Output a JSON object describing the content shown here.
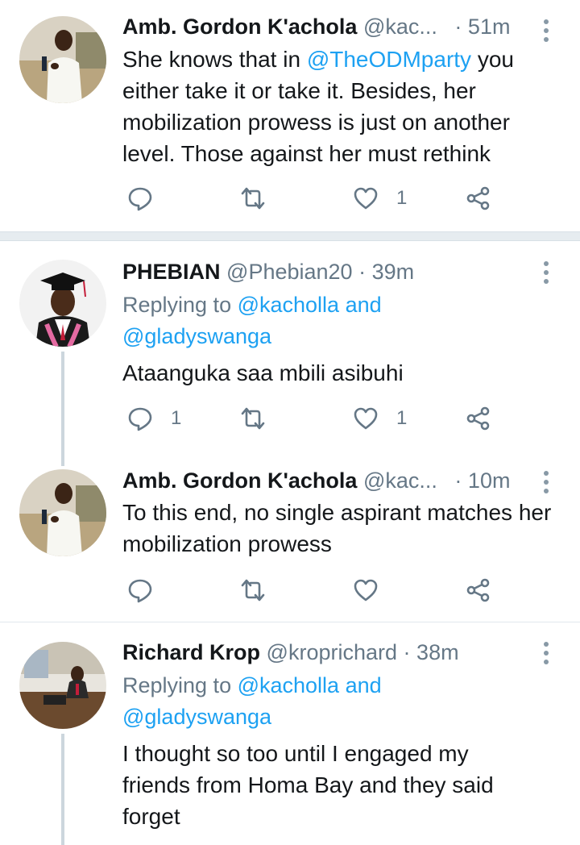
{
  "tweets": [
    {
      "name": "Amb. Gordon K'achola",
      "handle": "@kac...",
      "dot": "·",
      "time": "51m",
      "text_parts": [
        "She knows that in ",
        "@TheODMparty",
        " you either take it or take it. Besides, her mobilization prowess is just on another level. Those against her must rethink"
      ],
      "reply_count": "",
      "retweet_count": "",
      "like_count": "1"
    },
    {
      "name": "PHEBIAN",
      "handle": "@Phebian20",
      "dot": "·",
      "time": "39m",
      "replying_label": "Replying to ",
      "replying_to_1": "@kacholla and",
      "replying_to_2": "@gladyswanga",
      "text": "Ataanguka saa mbili asibuhi",
      "reply_count": "1",
      "retweet_count": "",
      "like_count": "1"
    },
    {
      "name": "Amb. Gordon K'achola",
      "handle": "@kac...",
      "dot": "·",
      "time": "10m",
      "text": "To this end, no single aspirant matches her mobilization prowess",
      "reply_count": "",
      "retweet_count": "",
      "like_count": ""
    },
    {
      "name": "Richard Krop",
      "handle": "@kroprichard",
      "dot": "·",
      "time": "38m",
      "replying_label": "Replying to ",
      "replying_to_1": "@kacholla and",
      "replying_to_2": "@gladyswanga",
      "text": "I thought so too until I engaged my friends from Homa Bay and they said forget"
    }
  ],
  "colors": {
    "link": "#1da1f2",
    "secondary": "#657786",
    "thread_line": "#ccd6dd"
  },
  "icons": [
    "reply-icon",
    "retweet-icon",
    "like-icon",
    "share-icon",
    "more-icon"
  ]
}
